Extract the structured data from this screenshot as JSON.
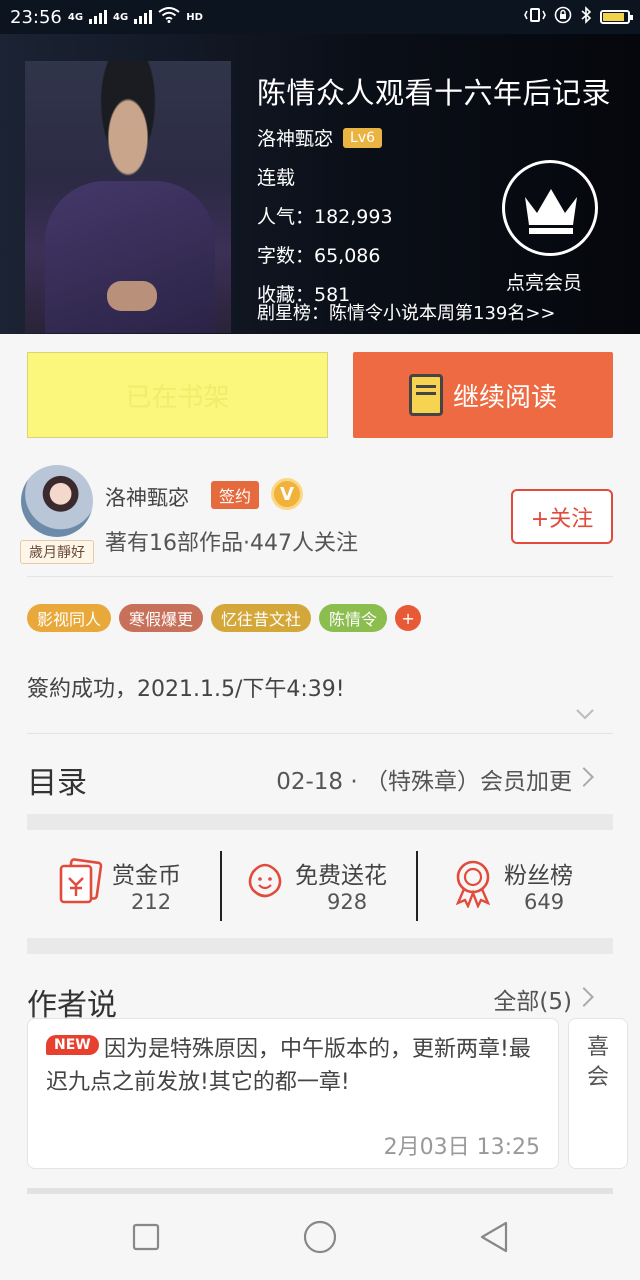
{
  "status_bar": {
    "time": "23:56",
    "net1": "4G",
    "net2": "4G",
    "hd": "HD"
  },
  "book": {
    "title": "陈情众人观看十六年后记录",
    "author": "洛神甄宓",
    "level": "Lv6",
    "status": "连载",
    "popularity": "人气：182,993",
    "word_count": "字数：65,086",
    "favorites": "收藏：581",
    "rank": "剧星榜：陈情令小说本周第139名>>"
  },
  "vip": {
    "label": "点亮会员"
  },
  "actions": {
    "shelf_label": "已在书架",
    "read_label": "继续阅读"
  },
  "author_card": {
    "name": "洛神甄宓",
    "sign_badge": "签约",
    "verified_badge": "V",
    "avatar_tag": "歲月靜好",
    "meta": "著有16部作品·447人关注",
    "follow_label": "+关注"
  },
  "tags": [
    {
      "label": "影视同人",
      "color": "#e9a93a"
    },
    {
      "label": "寒假爆更",
      "color": "#c8715a"
    },
    {
      "label": "忆往昔文社",
      "color": "#d4a73a"
    },
    {
      "label": "陈情令",
      "color": "#8bbd4f"
    }
  ],
  "tags_more": "+",
  "description": "簽約成功，2021.1.5/下午4:39!",
  "catalog": {
    "title": "目录",
    "latest": "02-18 · （特殊章）会员加更"
  },
  "stats": [
    {
      "label": "赏金币",
      "value": "212"
    },
    {
      "label": "免费送花",
      "value": "928"
    },
    {
      "label": "粉丝榜",
      "value": "649"
    }
  ],
  "author_says": {
    "title": "作者说",
    "all_label": "全部(5)",
    "new_badge": "NEW",
    "note": "因为是特殊原因，中午版本的，更新两章!最迟九点之前发放!其它的都一章!",
    "time": "2月03日  13:25",
    "next_preview": "喜会"
  },
  "colors": {
    "accent": "#ed6a43",
    "follow": "#e24b3b",
    "shelf_bg": "#fbf67c"
  }
}
